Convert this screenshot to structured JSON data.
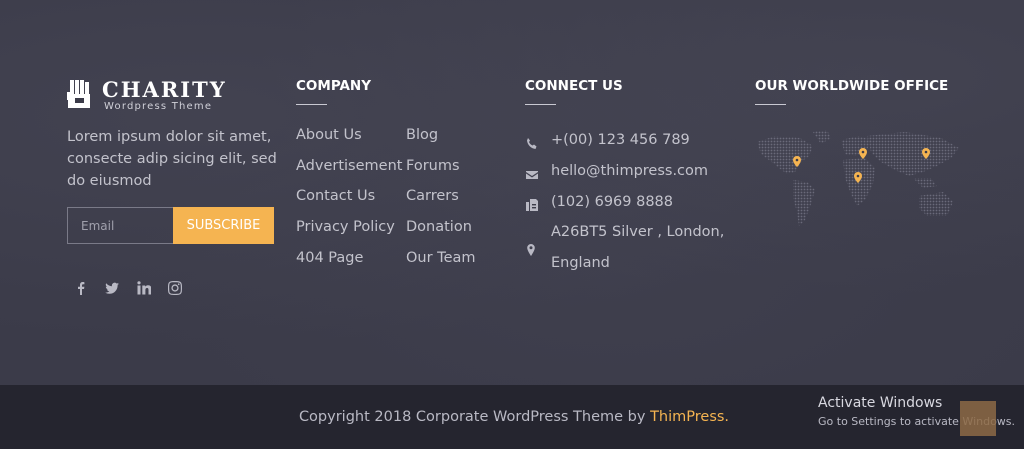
{
  "brand": {
    "name": "CHARITY",
    "tagline": "Wordpress Theme"
  },
  "about_text": "Lorem ipsum dolor sit amet, consecte adip sicing elit, sed do eiusmod",
  "newsletter": {
    "placeholder": "Email",
    "button_label": "SUBSCRIBE"
  },
  "social_icons": [
    "facebook-icon",
    "twitter-icon",
    "linkedin-icon",
    "instagram-icon"
  ],
  "company": {
    "heading": "COMPANY",
    "links_left": [
      "About Us",
      "Advertisement",
      "Contact Us",
      "Privacy Policy",
      "404 Page"
    ],
    "links_right": [
      "Blog",
      "Forums",
      "Carrers",
      "Donation",
      "Our Team"
    ]
  },
  "connect": {
    "heading": "CONNECT US",
    "phone": "+(00) 123 456 789",
    "email": "hello@thimpress.com",
    "fax": "(102) 6969 8888",
    "address_line1": "A26BT5 Silver , London,",
    "address_line2": "England"
  },
  "office": {
    "heading": "OUR WORLDWIDE OFFICE"
  },
  "footer_bottom": {
    "copyright_prefix": "Copyright 2018 Corporate WordPress Theme by ",
    "copyright_brand": "ThimPress."
  },
  "windows_watermark": {
    "title": "Activate Windows",
    "subtitle": "Go to Settings to activate Windows."
  },
  "colors": {
    "accent": "#f5b451",
    "background": "#3b3b49",
    "bottom_bar": "#25252f"
  }
}
